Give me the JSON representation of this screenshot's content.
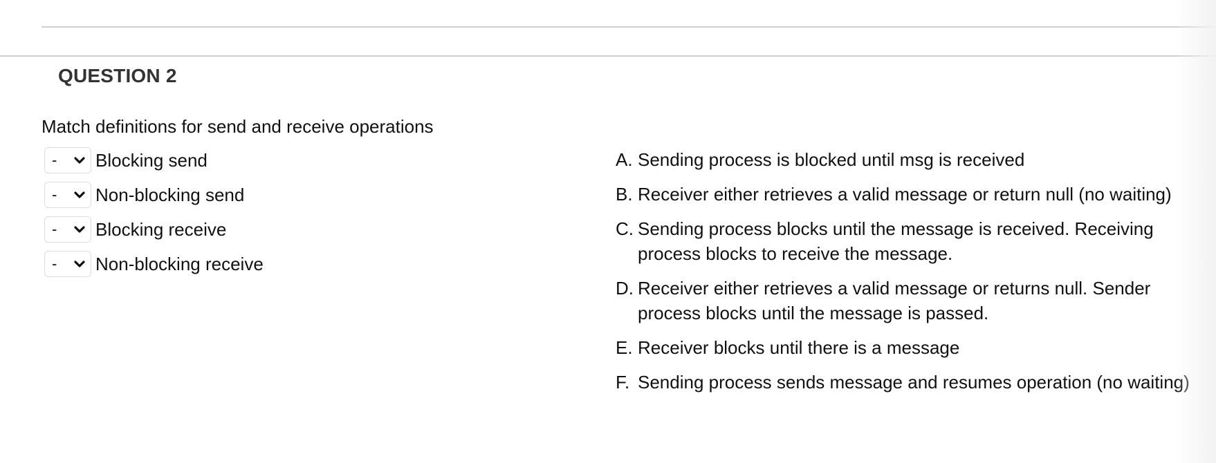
{
  "question": {
    "title": "QUESTION 2",
    "instructions": "Match definitions for send and receive operations"
  },
  "prompts": [
    {
      "select_value": "-",
      "label": "Blocking send"
    },
    {
      "select_value": "-",
      "label": "Non-blocking send"
    },
    {
      "select_value": "-",
      "label": "Blocking receive"
    },
    {
      "select_value": "-",
      "label": "Non-blocking receive"
    }
  ],
  "answers": [
    {
      "letter": "A.",
      "text": "Sending process is blocked until msg is received"
    },
    {
      "letter": "B.",
      "text": "Receiver either retrieves a valid message or return null (no waiting)"
    },
    {
      "letter": "C.",
      "text": "Sending process blocks until the message is received. Receiving process blocks to receive the message."
    },
    {
      "letter": "D.",
      "text": "Receiver either retrieves a valid message or returns null. Sender process blocks until the message is passed."
    },
    {
      "letter": "E.",
      "text": "Receiver blocks until there is a message"
    },
    {
      "letter": "F.",
      "text": "Sending process sends message and resumes operation (no waiting)"
    }
  ],
  "icons": {
    "dropdown": "chevron-down-icon"
  }
}
